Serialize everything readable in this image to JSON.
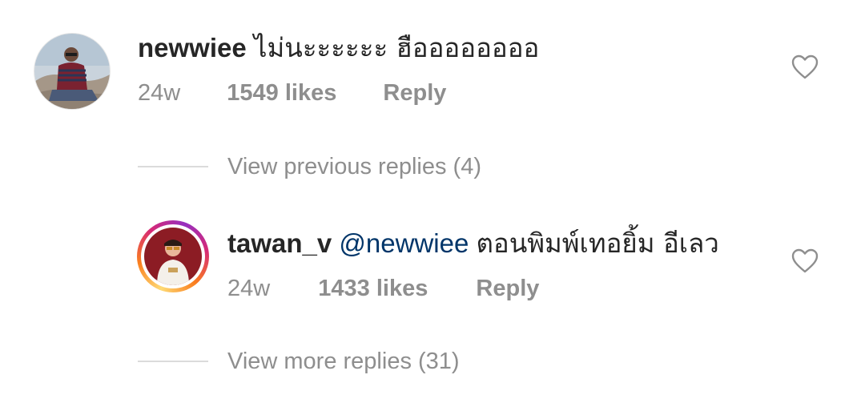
{
  "comment": {
    "username": "newwiee",
    "text": "ไม่นะะะะะะ ฮืออออออออ",
    "time": "24w",
    "likes": "1549 likes",
    "reply_label": "Reply"
  },
  "view_previous": "View previous replies (4)",
  "reply": {
    "username": "tawan_v",
    "mention": "@newwiee",
    "text": "ตอนพิมพ์เทอยิ้ม  อีเลว",
    "time": "24w",
    "likes": "1433 likes",
    "reply_label": "Reply"
  },
  "view_more": "View more replies (31)",
  "icons": {
    "like": "heart-outline-icon"
  },
  "colors": {
    "mention": "#003569",
    "meta": "#8e8e8e",
    "text": "#262626"
  }
}
